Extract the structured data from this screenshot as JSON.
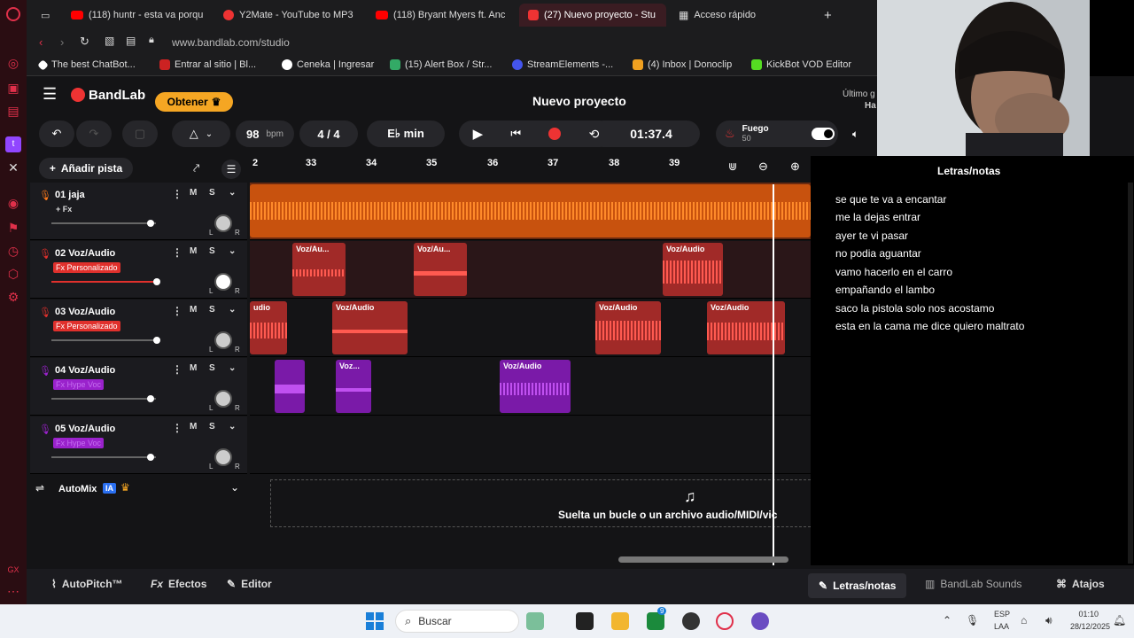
{
  "browser": {
    "tabs": [
      {
        "label": "(118) huntr - esta va porqu",
        "icon": "youtube-icon"
      },
      {
        "label": "Y2Mate - YouTube to MP3",
        "icon": "y2mate-icon"
      },
      {
        "label": "(118) Bryant Myers ft. Anc",
        "icon": "youtube-icon"
      },
      {
        "label": "(27) Nuevo proyecto - Stu",
        "icon": "bandlab-icon",
        "active": true
      },
      {
        "label": "Acceso rápido",
        "icon": "grid-icon"
      }
    ],
    "url": "www.bandlab.com/studio",
    "bookmarks": [
      {
        "label": "The best ChatBot...",
        "color": "#ffffff"
      },
      {
        "label": "Entrar al sitio | Bl...",
        "color": "#cc2222"
      },
      {
        "label": "Ceneka | Ingresar",
        "color": "#ffffff"
      },
      {
        "label": "(15) Alert Box / Str...",
        "color": "#33aa66"
      },
      {
        "label": "StreamElements -...",
        "color": "#4455ee"
      },
      {
        "label": "(4) Inbox | Donoclip",
        "color": "#f0a020"
      },
      {
        "label": "KickBot VOD Editor",
        "color": "#55dd22"
      }
    ]
  },
  "app": {
    "brand": "BandLab",
    "get_button": "Obtener",
    "project_title": "Nuevo proyecto",
    "last_saved": "Último g",
    "last_saved_2": "Ha",
    "bpm": "98",
    "bpm_unit": "bpm",
    "time_signature": "4 / 4",
    "key": "E♭ min",
    "time": "01:37.4",
    "fuego_label": "Fuego",
    "fuego_value": "50",
    "add_track": "Añadir pista",
    "ruler": [
      "2",
      "33",
      "34",
      "35",
      "36",
      "37",
      "38",
      "39"
    ],
    "tracks": [
      {
        "name": "01  jaja",
        "fx": "+ Fx",
        "fx_style": "plain",
        "color": "#ff7a1a",
        "slider": 0.93
      },
      {
        "name": "02  Voz/Audio",
        "fx": "Fx Personalizado",
        "fx_style": "red",
        "color": "#e0302c",
        "slider": 1.0
      },
      {
        "name": "03  Voz/Audio",
        "fx": "Fx Personalizado",
        "fx_style": "red",
        "color": "#e0302c",
        "slider": 1.0
      },
      {
        "name": "04  Voz/Audio",
        "fx": "Fx Hype Voc",
        "fx_style": "purple",
        "color": "#9a22cc",
        "slider": 0.93
      },
      {
        "name": "05  Voz/Audio",
        "fx": "Fx Hype Voc",
        "fx_style": "purple",
        "color": "#9a22cc",
        "slider": 0.93
      }
    ],
    "mute_label": "M",
    "solo_label": "S",
    "clips": {
      "track2": [
        "Voz/Au...",
        "Voz/Au...",
        "Voz/Audio"
      ],
      "track3": [
        "udio",
        "Voz/Audio",
        "Voz/Audio",
        "Voz/Audio"
      ],
      "track4": [
        "",
        "Voz...",
        "Voz/Audio"
      ]
    },
    "automix": "AutoMix",
    "automix_badge": "IA",
    "drop_text": "Suelta un bucle o un archivo audio/MIDI/vic",
    "notes_title": "Letras/notas",
    "notes": [
      "se que te va a encantar",
      "me la dejas  entrar",
      "ayer te vi pasar",
      "no podia aguantar",
      "vamo hacerlo en el carro",
      "empañando el lambo",
      "saco la pistola solo nos acostamo",
      "esta en la  cama me dice quiero maltrato"
    ],
    "bottom": {
      "autopitch": "AutoPitch™",
      "effects": "Efectos",
      "editor": "Editor",
      "lyrics": "Letras/notas",
      "sounds": "BandLab Sounds",
      "shortcuts": "Atajos"
    }
  },
  "taskbar": {
    "search": "Buscar",
    "lang": "ESP",
    "lang2": "LAA",
    "clock_time": "01:10",
    "clock_date": "28/12/2025",
    "badge": "9"
  }
}
